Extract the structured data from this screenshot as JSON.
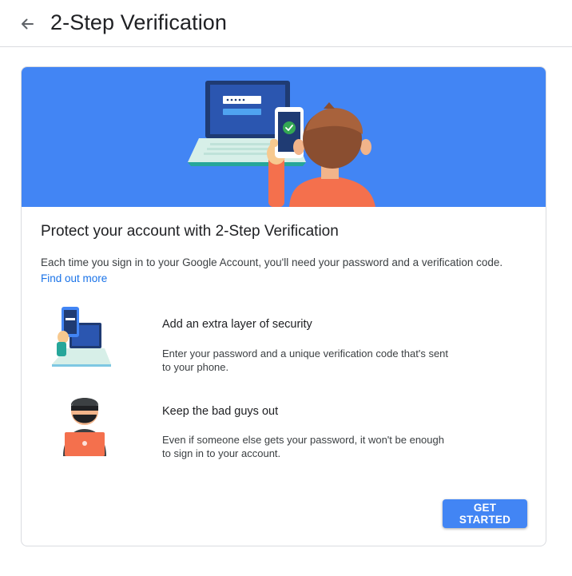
{
  "header": {
    "title": "2-Step Verification",
    "back_icon": "arrow-back-icon"
  },
  "card": {
    "heading": "Protect your account with 2-Step Verification",
    "intro_text": "Each time you sign in to your Google Account, you'll need your password and a verification code.",
    "intro_link": "Find out more",
    "features": [
      {
        "icon": "phone-laptop-illustration",
        "title": "Add an extra layer of security",
        "description": "Enter your password and a unique verification code that's sent to your phone."
      },
      {
        "icon": "masked-hacker-illustration",
        "title": "Keep the bad guys out",
        "description": "Even if someone else gets your password, it won't be enough to sign in to your account."
      }
    ],
    "button_label": "GET STARTED"
  },
  "colors": {
    "accent": "#4285f4",
    "link": "#1a73e8",
    "hero_bg": "#4285f4"
  }
}
